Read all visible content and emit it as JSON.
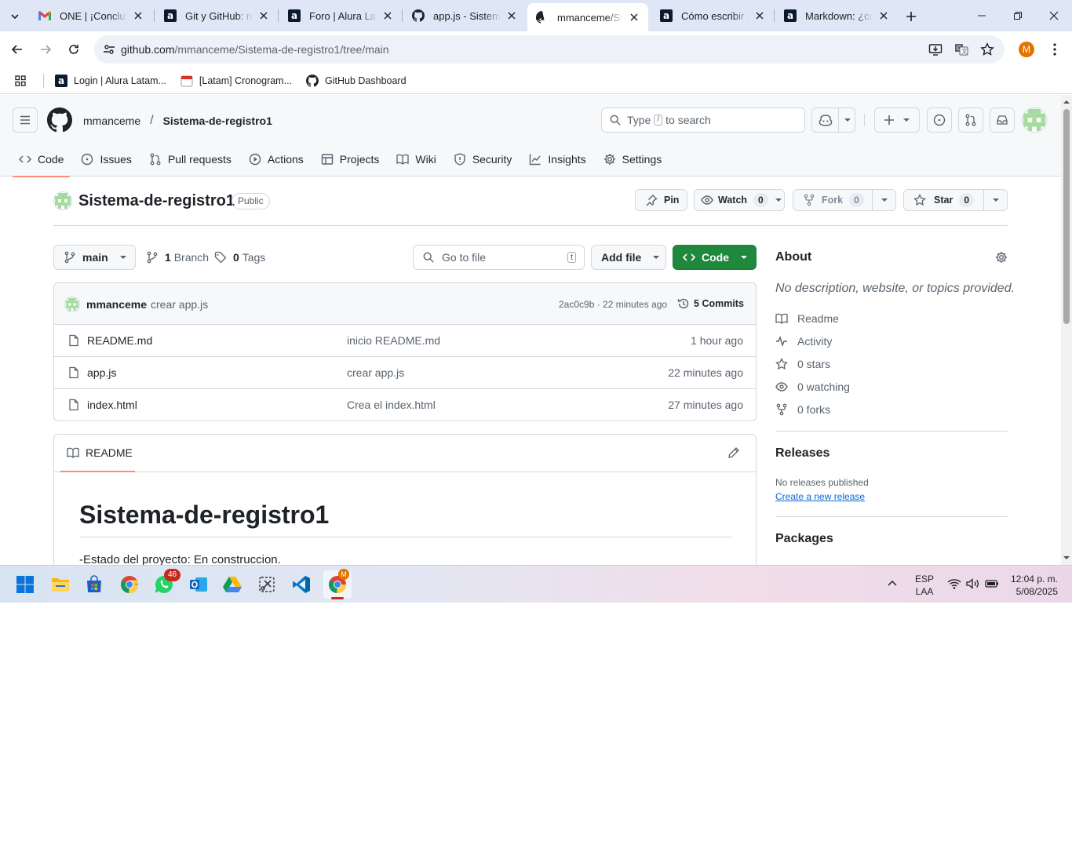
{
  "browser": {
    "tabs": [
      {
        "title": "ONE | ¡Concluye",
        "icon": "gmail-icon"
      },
      {
        "title": "Git y GitHub: rep",
        "icon": "alura-icon"
      },
      {
        "title": "Foro | Alura Lata",
        "icon": "alura-icon"
      },
      {
        "title": "app.js - Sistema-",
        "icon": "github-icon"
      },
      {
        "title": "mmanceme/Sist",
        "icon": "github-icon",
        "active": true
      },
      {
        "title": "Cómo escribir ur",
        "icon": "alura-icon"
      },
      {
        "title": "Markdown: ¿cóm",
        "icon": "alura-icon"
      }
    ],
    "alura_letter": "a",
    "url_host": "github.com",
    "url_path": "/mmanceme/Sistema-de-registro1/tree/main",
    "profile_initial": "M",
    "bookmarks": [
      {
        "label": "Login | Alura Latam...",
        "icon": "alura-icon"
      },
      {
        "label": "[Latam] Cronogram...",
        "icon": "calendar-icon"
      },
      {
        "label": "GitHub Dashboard",
        "icon": "github-icon"
      }
    ]
  },
  "github": {
    "owner": "mmanceme",
    "separator": "/",
    "repo": "Sistema-de-registro1",
    "search_prefix": "Type",
    "search_key": "/",
    "search_suffix": "to search",
    "nav": [
      "Code",
      "Issues",
      "Pull requests",
      "Actions",
      "Projects",
      "Wiki",
      "Security",
      "Insights",
      "Settings"
    ],
    "visibility": "Public",
    "pin_label": "Pin",
    "watch_label": "Watch",
    "watch_count": "0",
    "fork_label": "Fork",
    "fork_count": "0",
    "star_label": "Star",
    "star_count": "0",
    "branch": "main",
    "branches_count": "1",
    "branches_label": "Branch",
    "tags_count": "0",
    "tags_label": "Tags",
    "goto_placeholder": "Go to file",
    "goto_key": "t",
    "add_file_label": "Add file",
    "code_label": "Code",
    "latest_commit": {
      "author": "mmanceme",
      "message": "crear app.js",
      "hash_time": "2ac0c9b · 22 minutes ago",
      "commits_count": "5",
      "commits_label": "Commits"
    },
    "files": [
      {
        "name": "README.md",
        "message": "inicio README.md",
        "time": "1 hour ago"
      },
      {
        "name": "app.js",
        "message": "crear app.js",
        "time": "22 minutes ago"
      },
      {
        "name": "index.html",
        "message": "Crea el index.html",
        "time": "27 minutes ago"
      }
    ],
    "readme": {
      "tab_label": "README",
      "heading": "Sistema-de-registro1",
      "first_line": "-Estado del proyecto: En construccion."
    },
    "about": {
      "title": "About",
      "description": "No description, website, or topics provided.",
      "items": [
        {
          "label": "Readme",
          "icon": "book-icon"
        },
        {
          "label": "Activity",
          "icon": "pulse-icon"
        },
        {
          "label": "0 stars",
          "icon": "star-icon"
        },
        {
          "label": "0 watching",
          "icon": "eye-icon"
        },
        {
          "label": "0 forks",
          "icon": "fork-icon"
        }
      ],
      "releases_title": "Releases",
      "releases_none": "No releases published",
      "releases_link": "Create a new release",
      "packages_title": "Packages"
    }
  },
  "taskbar": {
    "whatsapp_badge": "46",
    "chrome_badge": "M",
    "lang_line1": "ESP",
    "lang_line2": "LAA",
    "time": "12:04 p. m.",
    "date": "5/08/2025"
  }
}
